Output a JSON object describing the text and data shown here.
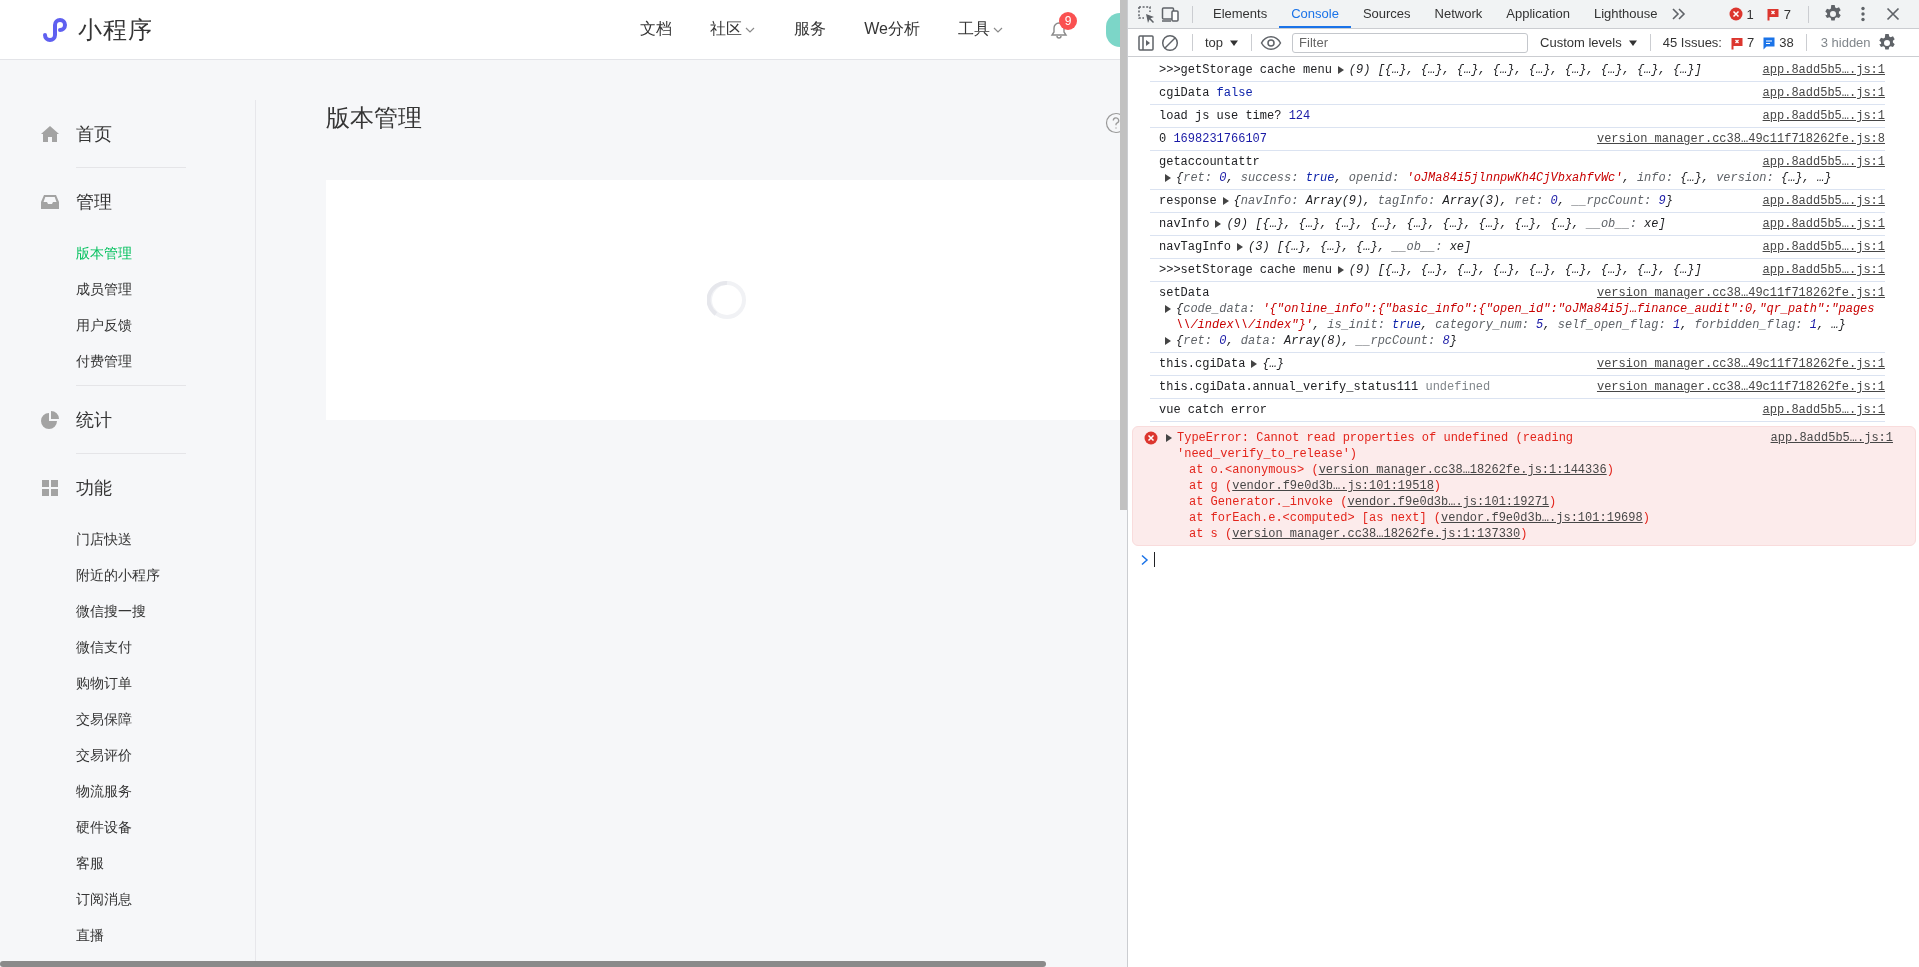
{
  "header": {
    "logo": "小程序",
    "nav": [
      {
        "label": "文档",
        "dropdown": false
      },
      {
        "label": "社区",
        "dropdown": true
      },
      {
        "label": "服务",
        "dropdown": false
      },
      {
        "label": "We分析",
        "dropdown": false
      },
      {
        "label": "工具",
        "dropdown": true
      }
    ],
    "notifications": "9"
  },
  "sidebar": {
    "groups": [
      {
        "title": "首页"
      },
      {
        "title": "管理",
        "items": [
          {
            "label": "版本管理",
            "selected": true
          },
          {
            "label": "成员管理",
            "selected": false
          },
          {
            "label": "用户反馈",
            "selected": false
          },
          {
            "label": "付费管理",
            "selected": false
          }
        ]
      },
      {
        "title": "统计"
      },
      {
        "title": "功能",
        "items": [
          {
            "label": "门店快送",
            "selected": false
          },
          {
            "label": "附近的小程序",
            "selected": false
          },
          {
            "label": "微信搜一搜",
            "selected": false
          },
          {
            "label": "微信支付",
            "selected": false
          },
          {
            "label": "购物订单",
            "selected": false
          },
          {
            "label": "交易保障",
            "selected": false
          },
          {
            "label": "交易评价",
            "selected": false
          },
          {
            "label": "物流服务",
            "selected": false
          },
          {
            "label": "硬件设备",
            "selected": false
          },
          {
            "label": "客服",
            "selected": false
          },
          {
            "label": "订阅消息",
            "selected": false
          },
          {
            "label": "直播",
            "selected": false
          }
        ]
      }
    ]
  },
  "page": {
    "title": "版本管理",
    "loading": true
  },
  "devtools": {
    "tabs": [
      {
        "label": "Elements",
        "selected": false
      },
      {
        "label": "Console",
        "selected": true
      },
      {
        "label": "Sources",
        "selected": false
      },
      {
        "label": "Network",
        "selected": false
      },
      {
        "label": "Application",
        "selected": false
      },
      {
        "label": "Lighthouse",
        "selected": false
      }
    ],
    "error_count": "1",
    "issue_count": "7",
    "context": "top",
    "filter": {
      "placeholder": "Filter"
    },
    "levels": "Custom levels",
    "issues": {
      "label": "45 Issues:",
      "errors": "7",
      "info": "38"
    },
    "hidden": "3 hidden",
    "messages": [
      {
        "kind": "log",
        "source": "app.8add5b5….js:1",
        "lines": [
          [
            {
              "t": ">>>getStorage cache menu"
            },
            {
              "kind": "toggle",
              "expanded": false
            },
            {
              "t": "(9) [{…}, {…}, {…}, {…}, {…}, {…}, {…}, {…}, {…}]"
            }
          ]
        ]
      },
      {
        "kind": "log",
        "source": "app.8add5b5….js:1",
        "lines": [
          [
            {
              "t": "cgiData "
            },
            {
              "kind": "keyword",
              "t": "false"
            }
          ]
        ]
      },
      {
        "kind": "log",
        "source": "app.8add5b5….js:1",
        "lines": [
          [
            {
              "t": "load js use time? "
            },
            {
              "kind": "number",
              "t": "124"
            }
          ]
        ]
      },
      {
        "kind": "log",
        "source": "version_manager.cc38…49c11f718262fe.js:8",
        "lines": [
          [
            {
              "t": "0 "
            },
            {
              "kind": "number",
              "t": "1698231766107"
            }
          ]
        ]
      },
      {
        "kind": "log",
        "source": "app.8add5b5….js:1",
        "lines": [
          [
            {
              "t": "getaccountattr"
            }
          ],
          [
            {
              "kind": "toggle",
              "expanded": false
            },
            {
              "t": "{"
            },
            {
              "kind": "key",
              "t": "ret: "
            },
            {
              "kind": "number",
              "t": "0"
            },
            {
              "t": ", "
            },
            {
              "kind": "key",
              "t": "success: "
            },
            {
              "kind": "keyword",
              "t": "true"
            },
            {
              "t": ", "
            },
            {
              "kind": "key",
              "t": "openid: "
            },
            {
              "kind": "string",
              "t": "'oJMa84i5jlnnpwKh4CjVbxahfvWc'"
            },
            {
              "t": ", "
            },
            {
              "kind": "key",
              "t": "info: "
            },
            {
              "t": "{…}, "
            },
            {
              "kind": "key",
              "t": "version: "
            },
            {
              "t": "{…}, …}"
            }
          ]
        ]
      },
      {
        "kind": "log",
        "source": "app.8add5b5….js:1",
        "lines": [
          [
            {
              "t": "response"
            },
            {
              "kind": "toggle",
              "expanded": false
            },
            {
              "t": "{"
            },
            {
              "kind": "key",
              "t": "navInfo: "
            },
            {
              "t": "Array(9), "
            },
            {
              "kind": "key",
              "t": "tagInfo: "
            },
            {
              "t": "Array(3), "
            },
            {
              "kind": "key",
              "t": "ret: "
            },
            {
              "kind": "number",
              "t": "0"
            },
            {
              "t": ", "
            },
            {
              "kind": "key",
              "t": "__rpcCount: "
            },
            {
              "kind": "number",
              "t": "9"
            },
            {
              "t": "}"
            }
          ]
        ]
      },
      {
        "kind": "log",
        "source": "app.8add5b5….js:1",
        "lines": [
          [
            {
              "t": "navInfo"
            },
            {
              "kind": "toggle",
              "expanded": false
            },
            {
              "t": "(9) [{…}, {…}, {…}, {…}, {…}, {…}, {…}, {…}, {…}, "
            },
            {
              "kind": "key",
              "t": "__ob__: "
            },
            {
              "t": "xe]"
            }
          ]
        ]
      },
      {
        "kind": "log",
        "source": "app.8add5b5….js:1",
        "lines": [
          [
            {
              "t": "navTagInfo"
            },
            {
              "kind": "toggle",
              "expanded": false
            },
            {
              "t": "(3) [{…}, {…}, {…}, "
            },
            {
              "kind": "key",
              "t": "__ob__: "
            },
            {
              "t": "xe]"
            }
          ]
        ]
      },
      {
        "kind": "log",
        "source": "app.8add5b5….js:1",
        "lines": [
          [
            {
              "t": ">>>setStorage cache menu"
            },
            {
              "kind": "toggle",
              "expanded": false
            },
            {
              "t": "(9) [{…}, {…}, {…}, {…}, {…}, {…}, {…}, {…}, {…}]"
            }
          ]
        ]
      },
      {
        "kind": "log",
        "source": "version_manager.cc38…49c11f718262fe.js:1",
        "lines": [
          [
            {
              "t": "setData"
            }
          ],
          [
            {
              "kind": "toggle",
              "expanded": false
            },
            {
              "t": "{"
            },
            {
              "kind": "key",
              "t": "code_data: "
            },
            {
              "kind": "string",
              "t": "'{\"online_info\":{\"basic_info\":{\"open_id\":\"oJMa84i5j…finance_audit\":0,\"qr_path\":\"pages\\\\/index\\\\/index\"}'"
            },
            {
              "t": ", "
            },
            {
              "kind": "key",
              "t": "is_init: "
            },
            {
              "kind": "keyword",
              "t": "true"
            },
            {
              "t": ", "
            },
            {
              "kind": "key",
              "t": "category_num: "
            },
            {
              "kind": "number",
              "t": "5"
            },
            {
              "t": ", "
            },
            {
              "kind": "key",
              "t": "self_open_flag: "
            },
            {
              "kind": "number",
              "t": "1"
            },
            {
              "t": ", "
            },
            {
              "kind": "key",
              "t": "forbidden_flag: "
            },
            {
              "kind": "number",
              "t": "1"
            },
            {
              "t": ", …}"
            }
          ],
          [
            {
              "kind": "toggle",
              "expanded": false
            },
            {
              "t": "{"
            },
            {
              "kind": "key",
              "t": "ret: "
            },
            {
              "kind": "number",
              "t": "0"
            },
            {
              "t": ", "
            },
            {
              "kind": "key",
              "t": "data: "
            },
            {
              "t": "Array(8), "
            },
            {
              "kind": "key",
              "t": "__rpcCount: "
            },
            {
              "kind": "number",
              "t": "8"
            },
            {
              "t": "}"
            }
          ]
        ]
      },
      {
        "kind": "log",
        "source": "version_manager.cc38…49c11f718262fe.js:1",
        "lines": [
          [
            {
              "t": "this.cgiData"
            },
            {
              "kind": "toggle",
              "expanded": false
            },
            {
              "t": "{…}"
            }
          ]
        ]
      },
      {
        "kind": "log",
        "source": "version_manager.cc38…49c11f718262fe.js:1",
        "lines": [
          [
            {
              "t": "this.cgiData.annual_verify_status111 "
            },
            {
              "kind": "undefined",
              "t": "undefined"
            }
          ]
        ]
      },
      {
        "kind": "log",
        "source": "app.8add5b5….js:1",
        "lines": [
          [
            {
              "t": "vue catch error"
            }
          ]
        ]
      },
      {
        "kind": "error",
        "source": "app.8add5b5….js:1",
        "lines": [
          [
            {
              "kind": "toggle",
              "expanded": false
            },
            {
              "t": "TypeError: Cannot read properties of undefined (reading\n'need_verify_to_release')"
            }
          ]
        ],
        "stack": [
          [
            {
              "t": "at o.<anonymous> ("
            },
            {
              "kind": "link",
              "t": "version_manager.cc38…18262fe.js:1:144336"
            },
            {
              "t": ")"
            }
          ],
          [
            {
              "t": "at g ("
            },
            {
              "kind": "link",
              "t": "vendor.f9e0d3b….js:101:19518"
            },
            {
              "t": ")"
            }
          ],
          [
            {
              "t": "at Generator._invoke ("
            },
            {
              "kind": "link",
              "t": "vendor.f9e0d3b….js:101:19271"
            },
            {
              "t": ")"
            }
          ],
          [
            {
              "t": "at forEach.e.<computed> [as next] ("
            },
            {
              "kind": "link",
              "t": "vendor.f9e0d3b….js:101:19698"
            },
            {
              "t": ")"
            }
          ],
          [
            {
              "t": "at s ("
            },
            {
              "kind": "link",
              "t": "version_manager.cc38…18262fe.js:1:137330"
            },
            {
              "t": ")"
            }
          ]
        ]
      }
    ]
  }
}
